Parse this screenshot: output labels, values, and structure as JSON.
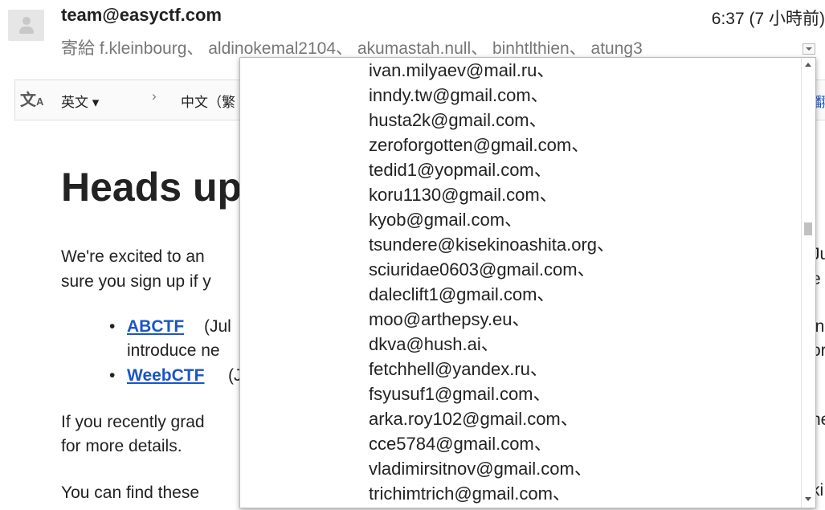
{
  "header": {
    "sender": "team@easyctf.com",
    "time": "6:37 (7 小時前)",
    "recipients_lead": "寄給",
    "recipients": "f.kleinbourg、 aldinokemal2104、 akumastah.null、 binhtlthien、 atung3"
  },
  "translate_bar": {
    "icon": "translate-icon",
    "source_lang": "英文 ▾",
    "arrow": "›",
    "target_lang": "中文（繁",
    "right_link": "翻"
  },
  "body": {
    "headline": "Heads up",
    "para1_line1": "We're excited to an",
    "para1_line2": "sure you sign up if y",
    "bullet1_link": "ABCTF",
    "bullet1_text": "(Jul",
    "bullet1_line2": "introduce ne",
    "bullet2_link": "WeebCTF",
    "bullet2_text": "(J",
    "para2_line1": "If you recently grad",
    "para2_line2": "for more details.",
    "para3_line1": "You can find these",
    "edge_texts": [
      "Ju",
      "e",
      "in",
      "or",
      "ne",
      "ki"
    ]
  },
  "dropdown": {
    "items": [
      "ivan.milyaev@mail.ru、",
      "inndy.tw@gmail.com、",
      "husta2k@gmail.com、",
      "zeroforgotten@gmail.com、",
      "tedid1@yopmail.com、",
      "koru1130@gmail.com、",
      "kyob@gmail.com、",
      "tsundere@kisekinoashita.org、",
      "sciuridae0603@gmail.com、",
      "daleclift1@gmail.com、",
      "moo@arthepsy.eu、",
      "dkva@hush.ai、",
      "fetchhell@yandex.ru、",
      "fsyusuf1@gmail.com、",
      "arka.roy102@gmail.com、",
      "cce5784@gmail.com、",
      "vladimirsitnov@gmail.com、",
      "trichimtrich@gmail.com、"
    ]
  }
}
